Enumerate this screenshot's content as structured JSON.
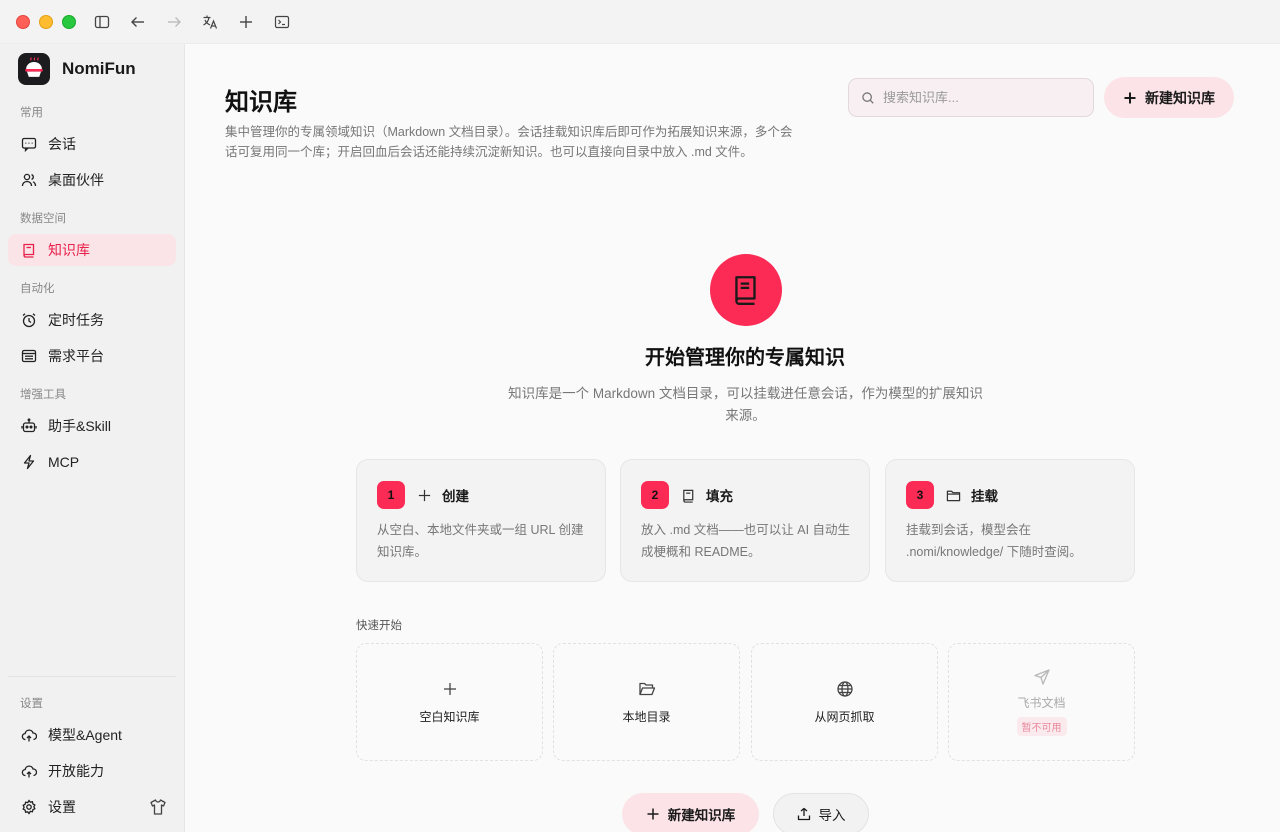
{
  "app": {
    "name": "NomiFun"
  },
  "sidebar": {
    "sections": [
      {
        "label": "常用"
      },
      {
        "label": "数据空间"
      },
      {
        "label": "自动化"
      },
      {
        "label": "增强工具"
      },
      {
        "label": "设置"
      }
    ],
    "items": [
      {
        "label": "会话",
        "icon": "chat-icon"
      },
      {
        "label": "桌面伙伴",
        "icon": "users-icon"
      },
      {
        "label": "知识库",
        "icon": "book-icon",
        "active": true
      },
      {
        "label": "定时任务",
        "icon": "alarm-clock-icon"
      },
      {
        "label": "需求平台",
        "icon": "list-icon"
      },
      {
        "label": "助手&Skill",
        "icon": "robot-icon"
      },
      {
        "label": "MCP",
        "icon": "bolt-icon"
      },
      {
        "label": "模型&Agent",
        "icon": "cloud-icon"
      },
      {
        "label": "开放能力",
        "icon": "cloud-icon"
      },
      {
        "label": "设置",
        "icon": "gear-icon"
      }
    ]
  },
  "header": {
    "title": "知识库",
    "description": "集中管理你的专属领域知识（Markdown 文档目录）。会话挂载知识库后即可作为拓展知识来源，多个会话可复用同一个库；开启回血后会话还能持续沉淀新知识。也可以直接向目录中放入 .md 文件。",
    "search_placeholder": "搜索知识库...",
    "new_button": "新建知识库"
  },
  "hero": {
    "title": "开始管理你的专属知识",
    "description": "知识库是一个 Markdown 文档目录，可以挂载进任意会话，作为模型的扩展知识来源。"
  },
  "steps": [
    {
      "num": "1",
      "title": "创建",
      "icon": "plus-icon",
      "text": "从空白、本地文件夹或一组 URL 创建知识库。"
    },
    {
      "num": "2",
      "title": "填充",
      "icon": "book-icon",
      "text": "放入 .md 文档——也可以让 AI 自动生成梗概和 README。"
    },
    {
      "num": "3",
      "title": "挂载",
      "icon": "folder-icon",
      "text": "挂载到会话，模型会在 .nomi/knowledge/ 下随时查阅。"
    }
  ],
  "quick_start": {
    "label": "快速开始",
    "items": [
      {
        "label": "空白知识库",
        "icon": "plus-icon"
      },
      {
        "label": "本地目录",
        "icon": "folder-open-icon"
      },
      {
        "label": "从网页抓取",
        "icon": "globe-icon"
      },
      {
        "label": "飞书文档",
        "icon": "send-icon",
        "badge": "暂不可用",
        "disabled": true
      }
    ]
  },
  "footer_buttons": {
    "new": "新建知识库",
    "import": "导入"
  },
  "colors": {
    "accent": "#fb2b55",
    "accent_soft": "#fbe3e7",
    "active_text": "#e8214a"
  }
}
